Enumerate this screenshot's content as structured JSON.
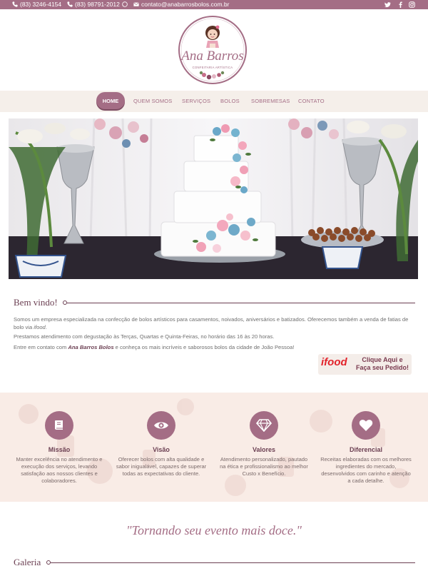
{
  "topbar": {
    "phone1": "(83) 3246-4154",
    "phone2": "(83) 98791-2012",
    "email": "contato@anabarrosbolos.com.br",
    "social": [
      "twitter-icon",
      "facebook-icon",
      "instagram-icon"
    ]
  },
  "logo": {
    "name": "Ana Barros",
    "tagline": "CONFEITARIA ARTÍSTICA"
  },
  "nav": {
    "home": "HOME",
    "about": "QUEM SOMOS",
    "services": "SERVIÇOS",
    "cakes": "BOLOS",
    "desserts": "SOBREMESAS",
    "contact": "CONTATO"
  },
  "welcome": {
    "title": "Bem vindo!",
    "p1": "Somos um empresa especializada na confecção de bolos artísticos para casamentos, noivados, aniversários e batizados. Oferecemos também a venda de fatias de bolo via ",
    "p1_em": "ifood",
    "p1_end": ".",
    "p2": "Prestamos atendimento com degustação às Terças, Quartas e Quinta-Feiras, no horário das 16 às 20 horas.",
    "p3_a": "Entre em contato com ",
    "p3_b": "Ana Barros Bolos",
    "p3_c": " e conheça os mais incríveis e saborosos bolos da cidade de João Pessoa!"
  },
  "ifood": {
    "brand": "ifood",
    "cta_line1": "Clique Aqui e",
    "cta_line2": "Faça seu Pedido!"
  },
  "features": [
    {
      "icon": "book-icon",
      "title": "Missão",
      "desc": "Manter excelência no atendimento e execução dos serviços, levando satisfação aos nossos clientes e colaboradores."
    },
    {
      "icon": "eye-icon",
      "title": "Visão",
      "desc": "Oferecer bolos com alta qualidade e sabor inigualável, capazes de superar todas as expectativas do cliente."
    },
    {
      "icon": "diamond-icon",
      "title": "Valores",
      "desc": "Atendimento personalizado, pautado na ética e profissionalismo ao melhor Custo x Benefício."
    },
    {
      "icon": "heart-icon",
      "title": "Diferencial",
      "desc": "Receitas elaboradas com os melhores ingredientes do mercado, desenvolvidos com carinho e atenção a cada detalhe."
    }
  ],
  "quote": "\"Tornando seu evento mais doce.\"",
  "gallery": {
    "title": "Galeria"
  },
  "colors": {
    "accent": "#a46d85",
    "dark_accent": "#6b3f52",
    "band": "#f9ece6",
    "nav_bg": "#f5efea"
  }
}
